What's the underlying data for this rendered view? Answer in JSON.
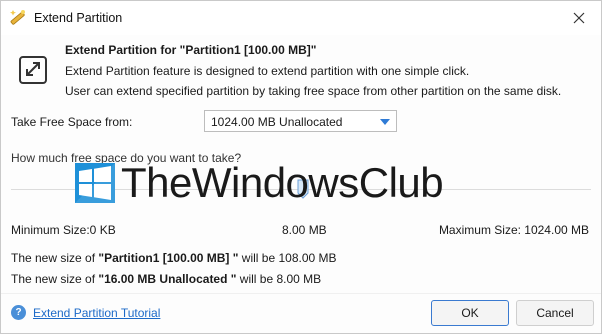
{
  "window": {
    "title": "Extend Partition",
    "icons": {
      "app": "wand-icon",
      "close": "close-icon"
    }
  },
  "header": {
    "title": "Extend Partition for \"Partition1 [100.00 MB]\"",
    "line1": "Extend Partition feature is designed to extend partition with one simple click.",
    "line2": "User can extend specified partition by taking free space from other partition on the same disk.",
    "icon": "expand-arrows-icon"
  },
  "take_from": {
    "label": "Take Free Space from:",
    "selected": "1024.00 MB Unallocated"
  },
  "question": "How much free space do you want to take?",
  "slider": {
    "position_fraction": 0.5
  },
  "watermark": {
    "text": "TheWindowsClub"
  },
  "sizes": {
    "minimum": "Minimum Size:0 KB",
    "current": "8.00 MB",
    "maximum": "Maximum Size: 1024.00 MB"
  },
  "new_size": {
    "line1_prefix": "The new size of ",
    "line1_name": "\"Partition1 [100.00 MB] \"",
    "line1_suffix": " will be 108.00 MB",
    "line2_prefix": "The new size of ",
    "line2_name": "\"16.00 MB Unallocated \"",
    "line2_suffix": " will be 8.00 MB"
  },
  "footer": {
    "tutorial_link": "Extend Partition Tutorial",
    "help_glyph": "?",
    "ok": "OK",
    "cancel": "Cancel"
  },
  "colors": {
    "accent": "#2f7bd6",
    "link": "#1d6ac8"
  }
}
